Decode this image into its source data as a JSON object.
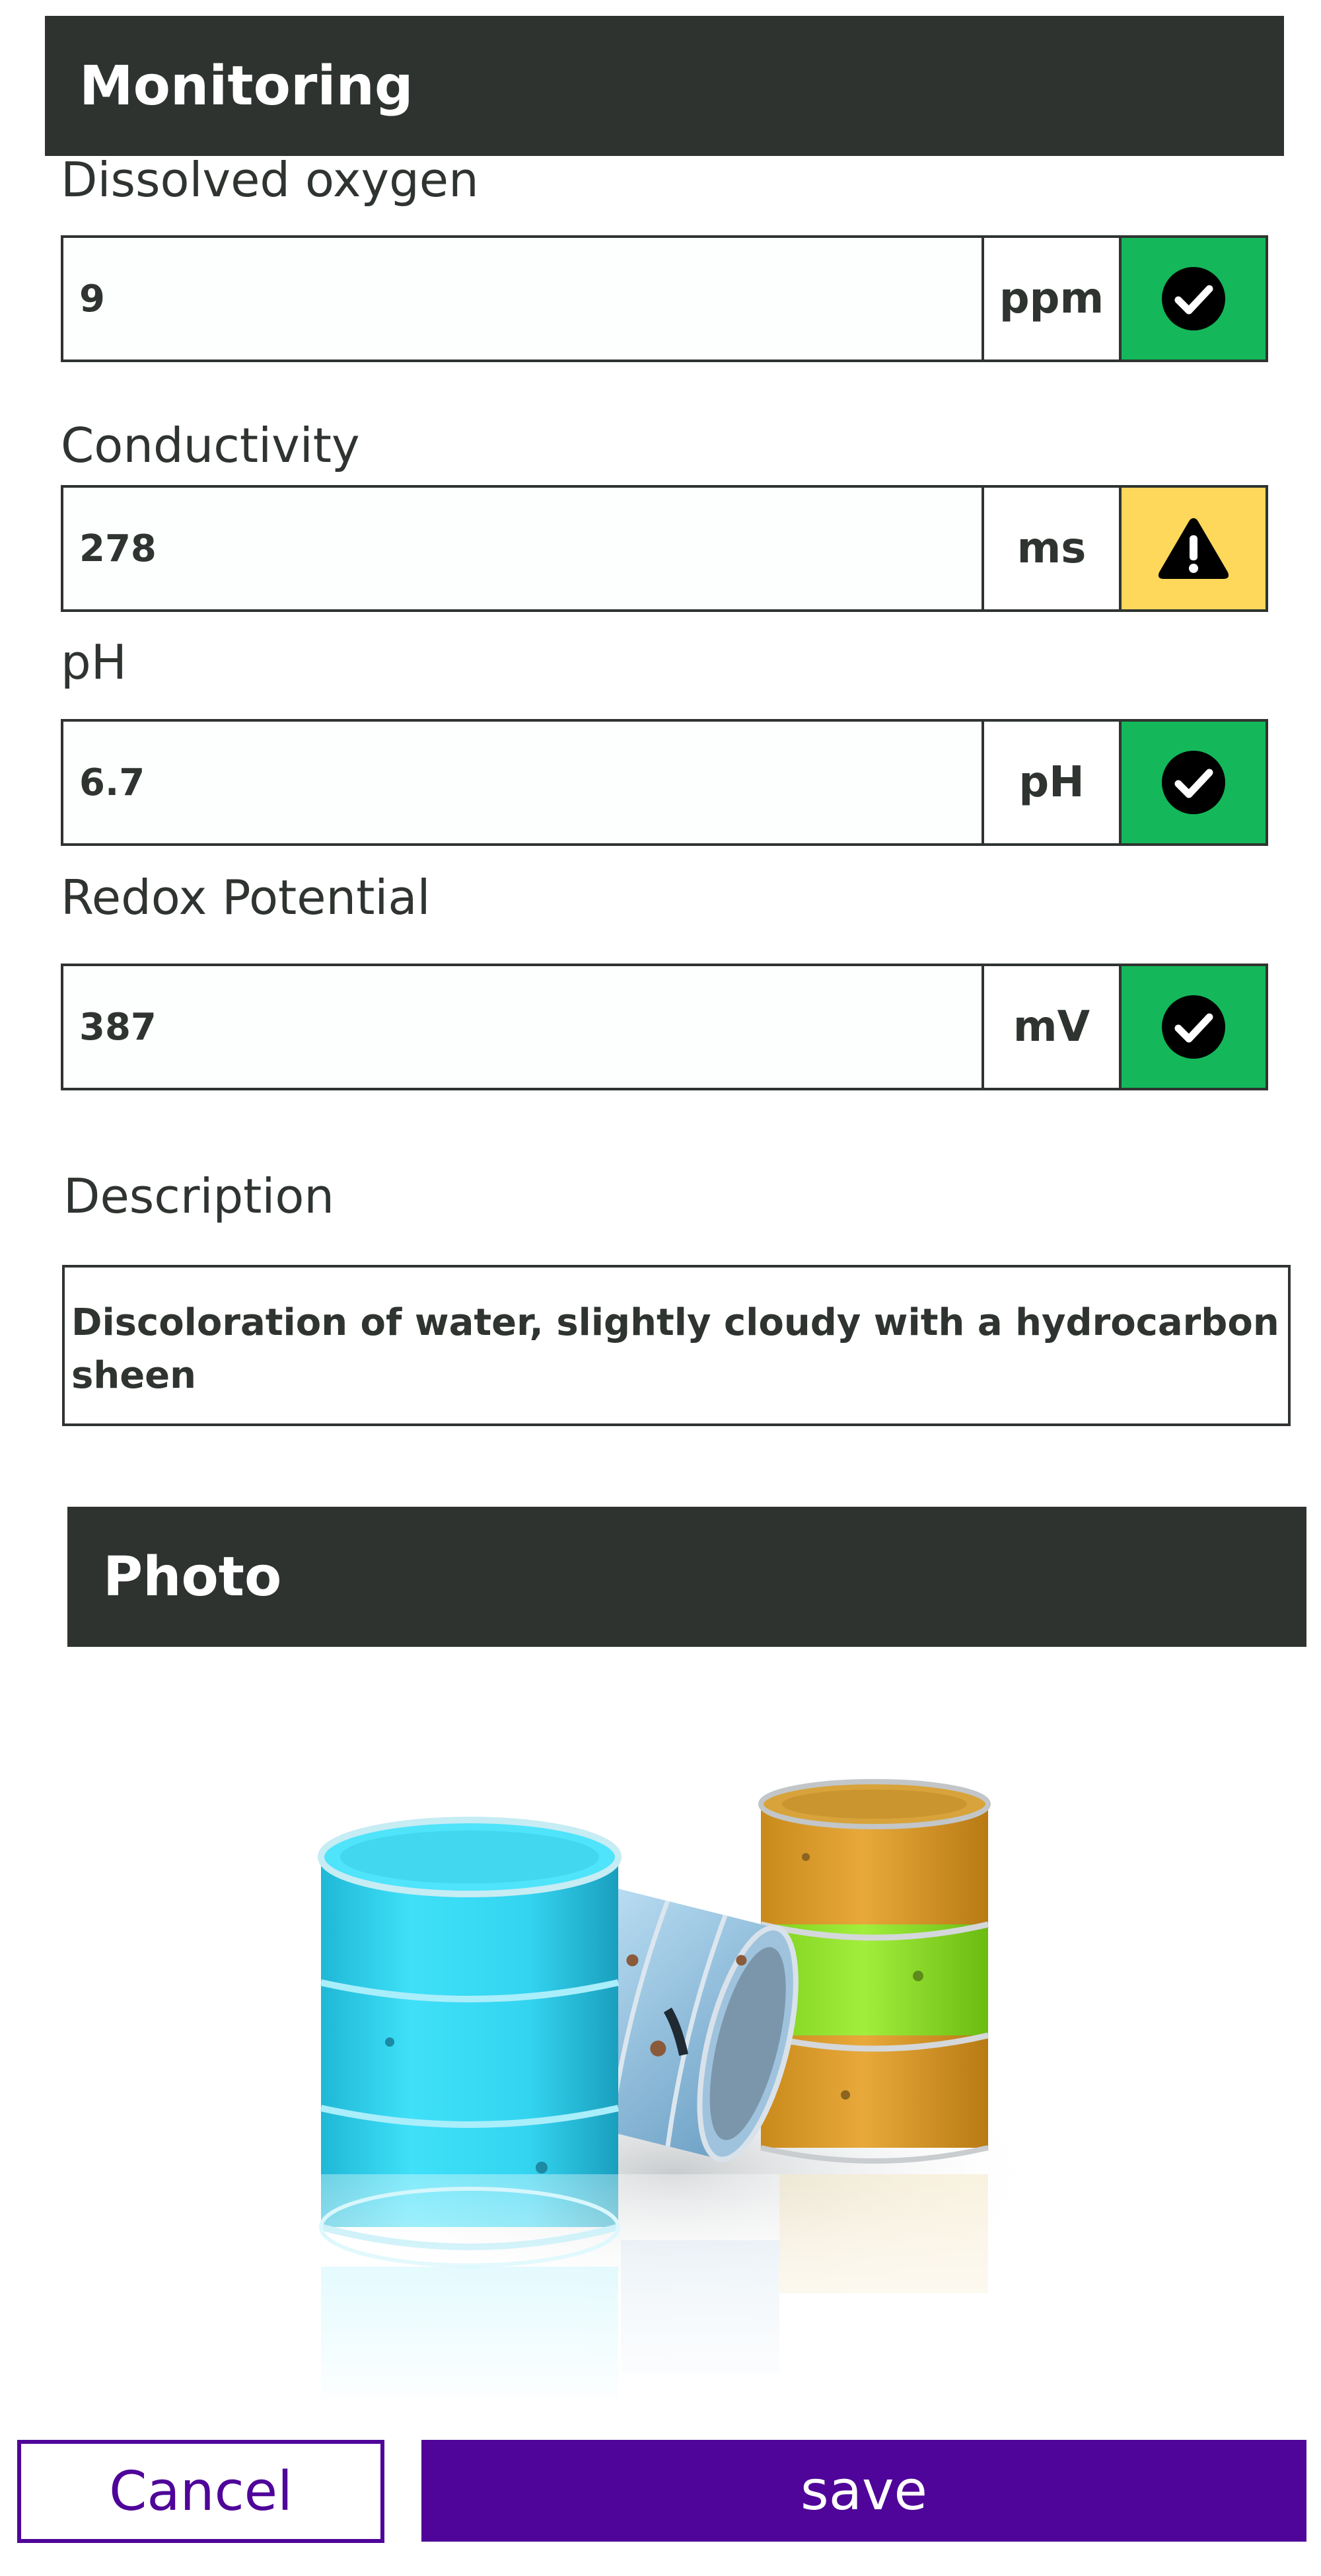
{
  "monitoring": {
    "title": "Monitoring",
    "fields": [
      {
        "label": "Dissolved oxygen",
        "value": "9",
        "unit": "ppm",
        "status": "ok",
        "status_icon": "check-circle-icon"
      },
      {
        "label": "Conductivity",
        "value": "278",
        "unit": "ms",
        "status": "warning",
        "status_icon": "warning-triangle-icon"
      },
      {
        "label": "pH",
        "value": "6.7",
        "unit": "pH",
        "status": "ok",
        "status_icon": "check-circle-icon"
      },
      {
        "label": "Redox Potential",
        "value": "387",
        "unit": "mV",
        "status": "ok",
        "status_icon": "check-circle-icon"
      }
    ],
    "description_label": "Description",
    "description_value": "Discoloration of water, slightly cloudy with a hydrocarbon sheen"
  },
  "photo": {
    "title": "Photo"
  },
  "actions": {
    "cancel_label": "Cancel",
    "save_label": "save"
  },
  "colors": {
    "header_bg": "#2e3330",
    "ok": "#14b85a",
    "warning": "#fdd85a",
    "primary": "#4f0599"
  }
}
